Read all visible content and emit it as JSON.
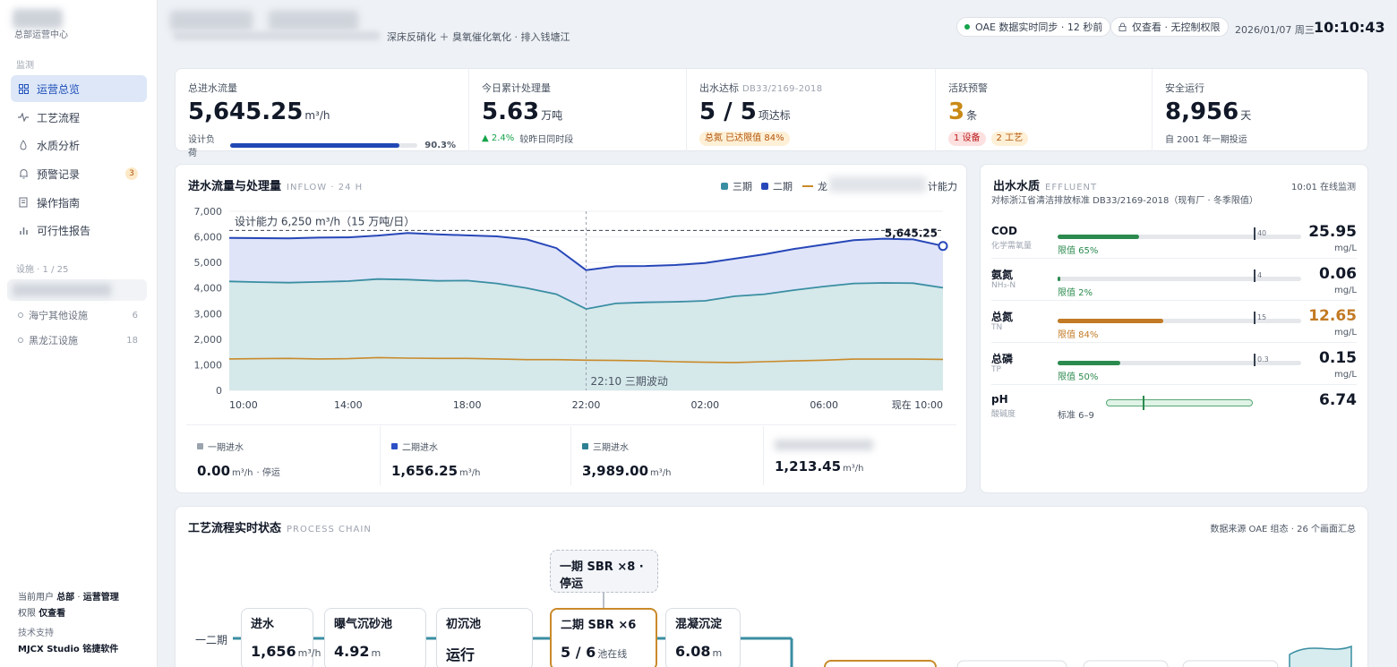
{
  "sidebar": {
    "brand_sub": "总部运营中心",
    "monitor_label": "监测",
    "nav": [
      {
        "label": "运营总览",
        "icon": "grid-icon",
        "active": true
      },
      {
        "label": "工艺流程",
        "icon": "pulse-icon"
      },
      {
        "label": "水质分析",
        "icon": "drop-icon"
      },
      {
        "label": "预警记录",
        "icon": "bell-icon",
        "badge": "3"
      },
      {
        "label": "操作指南",
        "icon": "book-icon"
      },
      {
        "label": "可行性报告",
        "icon": "bar-chart-icon"
      }
    ],
    "facility_label": "设施 · 1 / 25",
    "facilities": [
      {
        "label": "海宁其他设施",
        "count": "6"
      },
      {
        "label": "黑龙江设施",
        "count": "18"
      }
    ],
    "footer": {
      "user_prefix": "当前用户",
      "user_org": "总部",
      "user_role": "运营管理",
      "perm_prefix": "权限",
      "perm_value": "仅查看",
      "support_label": "技术支持",
      "support_value": "MJCX Studio 铭捷软件"
    }
  },
  "header": {
    "process_text": "深床反硝化 ＋ 臭氧催化氧化 · 排入钱塘江",
    "sync_text": "OAE 数据实时同步 · 12 秒前",
    "perm_text": "仅查看 · 无控制权限",
    "date": "2026/01/07 周三",
    "time": "10:10:43"
  },
  "kpis": {
    "inflow": {
      "label": "总进水流量",
      "value": "5,645.25",
      "unit": "m³/h",
      "meta_label": "设计负荷",
      "load_pct": 90.3,
      "load_text": "90.3%"
    },
    "today": {
      "label": "今日累计处理量",
      "value": "5.63",
      "unit": "万吨",
      "delta": "▲ 2.4%",
      "delta_text": "较昨日同时段"
    },
    "effluent": {
      "label": "出水达标",
      "sub": "DB33/2169-2018",
      "value": "5 / 5",
      "unit": "项达标",
      "tag": "总氮 已达限值 84%"
    },
    "alerts": {
      "label": "活跃预警",
      "value": "3",
      "unit": "条",
      "tag_device": "1 设备",
      "tag_process": "2 工艺"
    },
    "safety": {
      "label": "安全运行",
      "value": "8,956",
      "unit": "天",
      "meta": "自 2001 年一期投运"
    }
  },
  "inflow_chart": {
    "title": "进水流量与处理量",
    "title_en": "INFLOW · 24 H",
    "legend": {
      "s3": "三期",
      "s2": "二期",
      "s1": "龙",
      "cap": "计能力"
    },
    "footer": [
      {
        "label": "一期进水",
        "value": "0.00",
        "unit": "m³/h",
        "suffix": "· 停运",
        "color": "#9aa3ad"
      },
      {
        "label": "二期进水",
        "value": "1,656.25",
        "unit": "m³/h",
        "color": "#2b4fc4"
      },
      {
        "label": "三期进水",
        "value": "3,989.00",
        "unit": "m³/h",
        "color": "#2d7f93"
      },
      {
        "label": "",
        "value": "1,213.45",
        "unit": "m³/h",
        "color": "#c0c4ca"
      }
    ]
  },
  "chart_data": {
    "type": "area",
    "title": "进水流量与处理量",
    "x_tick_labels": [
      "10:00",
      "14:00",
      "18:00",
      "22:00",
      "02:00",
      "06:00",
      "现在 10:00"
    ],
    "x_hours": [
      0,
      1,
      2,
      3,
      4,
      5,
      6,
      7,
      8,
      9,
      10,
      11,
      12,
      13,
      14,
      15,
      16,
      17,
      18,
      19,
      20,
      21,
      22,
      23,
      24
    ],
    "ylim": [
      0,
      7000
    ],
    "yticks": [
      0,
      1000,
      2000,
      3000,
      4000,
      5000,
      6000,
      7000
    ],
    "y_tick_labels": [
      "0",
      "1,000",
      "2,000",
      "3,000",
      "4,000",
      "5,000",
      "6,000",
      "7,000"
    ],
    "series": [
      {
        "name": "三期",
        "color": "#3a8ea2",
        "values": [
          4260,
          4230,
          4210,
          4240,
          4270,
          4350,
          4330,
          4280,
          4290,
          4180,
          4000,
          3760,
          3180,
          3400,
          3440,
          3460,
          3500,
          3680,
          3760,
          3920,
          4060,
          4180,
          4200,
          4190,
          4010
        ]
      },
      {
        "name": "二期",
        "color": "#2747b8",
        "values": [
          5960,
          5950,
          5940,
          5970,
          5980,
          6050,
          6150,
          6100,
          6060,
          6020,
          5900,
          5560,
          4700,
          4850,
          4860,
          4900,
          4980,
          5150,
          5320,
          5530,
          5700,
          5870,
          5930,
          5900,
          5645
        ]
      },
      {
        "name": "龙",
        "color": "#c98a2a",
        "values": [
          1230,
          1240,
          1250,
          1230,
          1240,
          1280,
          1260,
          1250,
          1250,
          1230,
          1200,
          1200,
          1180,
          1170,
          1150,
          1120,
          1100,
          1090,
          1120,
          1150,
          1180,
          1220,
          1220,
          1220,
          1210
        ]
      }
    ],
    "capacity_line": {
      "value": 6250,
      "label": "设计能力 6,250 m³/h（15 万吨/日）"
    },
    "current_label": "5,645.25",
    "annotation": {
      "x_hour": 12,
      "label": "22:10 三期波动"
    },
    "grid": true
  },
  "effluent_quality": {
    "title": "出水水质",
    "title_en": "EFFLUENT",
    "subtitle": "对标浙江省清洁排放标准 DB33/2169-2018（现有厂 · 冬季限值）",
    "status": "10:01 在线监测",
    "rows": [
      {
        "name": "COD",
        "sub": "化学需氧量",
        "pct": 65,
        "pct_label": "限值 65%",
        "limit": "40",
        "value": "25.95",
        "unit": "mg/L",
        "color": "#2b8a4e"
      },
      {
        "name": "氨氮",
        "sub": "NH₃-N",
        "pct": 2,
        "pct_label": "限值 2%",
        "limit": "4",
        "value": "0.06",
        "unit": "mg/L",
        "color": "#2b8a4e"
      },
      {
        "name": "总氮",
        "sub": "TN",
        "pct": 84,
        "pct_label": "限值 84%",
        "limit": "15",
        "value": "12.65",
        "unit": "mg/L",
        "color": "#c27a25"
      },
      {
        "name": "总磷",
        "sub": "TP",
        "pct": 50,
        "pct_label": "限值 50%",
        "limit": "0.3",
        "value": "0.15",
        "unit": "mg/L",
        "color": "#2b8a4e"
      }
    ],
    "ph": {
      "name": "pH",
      "sub": "酸碱度",
      "range_label": "标准 6–9",
      "value": "6.74",
      "marker_pct": 25
    }
  },
  "process_chain": {
    "title": "工艺流程实时状态",
    "title_en": "PROCESS CHAIN",
    "source": "数据来源 OAE 组态 · 26 个画面汇总",
    "lane_label": "一二期",
    "top_node": "一期 SBR ×8 · 停运",
    "nodes": [
      {
        "title": "进水",
        "value": "1,656",
        "unit": "m³/h"
      },
      {
        "title": "曝气沉砂池",
        "value": "4.92",
        "unit": "m"
      },
      {
        "title": "初沉池",
        "value": "运行",
        "unit": ""
      },
      {
        "title": "二期 SBR ×6",
        "value": "5 / 6",
        "unit": "池在线"
      },
      {
        "title": "混凝沉淀",
        "value": "6.08",
        "unit": "m"
      }
    ]
  }
}
